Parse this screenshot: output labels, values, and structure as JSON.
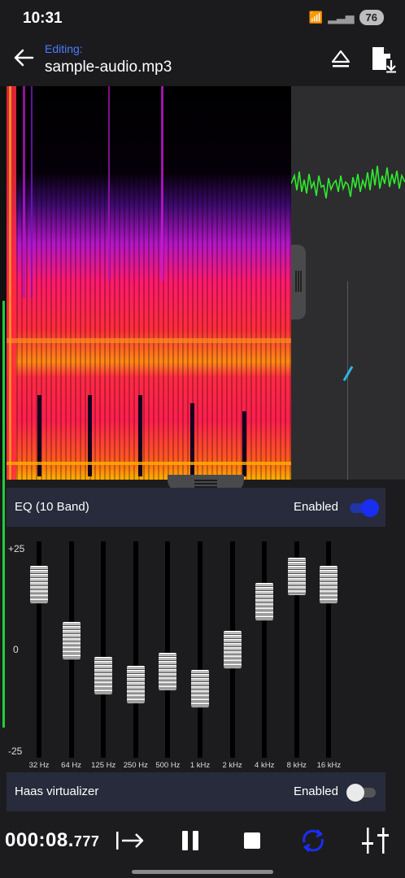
{
  "status_bar": {
    "time": "10:31",
    "battery": "76",
    "icons": [
      "wifi-calling-icon",
      "wifi-icon",
      "signal-icon"
    ]
  },
  "header": {
    "subtitle": "Editing:",
    "title": "sample-audio.mp3",
    "actions": [
      "eject-icon",
      "save-file-icon"
    ]
  },
  "eq_card": {
    "label": "EQ (10 Band)",
    "status": "Enabled",
    "on": true
  },
  "eq": {
    "y_max": "+25",
    "y_mid": "0",
    "y_min": "-25",
    "bands": [
      {
        "freq": "32 Hz",
        "gain_db": 15
      },
      {
        "freq": "64 Hz",
        "gain_db": 2
      },
      {
        "freq": "125 Hz",
        "gain_db": -6
      },
      {
        "freq": "250 Hz",
        "gain_db": -8
      },
      {
        "freq": "500 Hz",
        "gain_db": -5
      },
      {
        "freq": "1 kHz",
        "gain_db": -9
      },
      {
        "freq": "2 kHz",
        "gain_db": 0
      },
      {
        "freq": "4 kHz",
        "gain_db": 11
      },
      {
        "freq": "8 kHz",
        "gain_db": 17
      },
      {
        "freq": "16 kHz",
        "gain_db": 15
      }
    ]
  },
  "haas_card": {
    "label": "Haas virtualizer",
    "status": "Enabled",
    "on": false
  },
  "transport": {
    "time_main": "000:08.",
    "time_ms": "777",
    "buttons": [
      "skip-forward-icon",
      "pause-icon",
      "stop-icon",
      "loop-icon",
      "mixer-icon"
    ]
  },
  "colors": {
    "accent": "#1a2ef2",
    "waveform": "#2eea2e",
    "editing_label": "#4c7cff"
  }
}
